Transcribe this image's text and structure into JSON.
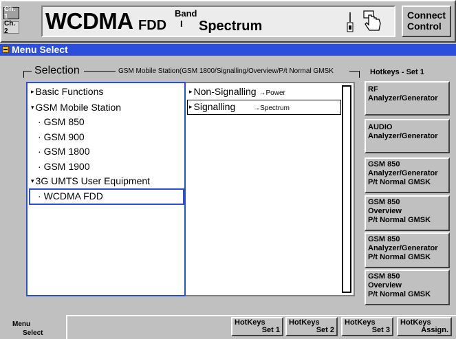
{
  "header": {
    "ch1": "Ch. 1",
    "ch2": "Ch. 2",
    "title_main": "WCDMA",
    "title_sub": "FDD",
    "band_label": "Band",
    "band_value": "I",
    "mode": "Spectrum",
    "connect_line1": "Connect",
    "connect_line2": "Control"
  },
  "menubar": {
    "label": "Menu Select"
  },
  "selection": {
    "title": "Selection",
    "path": "GSM Mobile Station(GSM 1800/Signalling/Overview/P/t Normal GMSK"
  },
  "left_list": [
    {
      "marker": "▸",
      "label": "Basic Functions"
    },
    {
      "marker": "▾",
      "label": "GSM Mobile Station"
    },
    {
      "marker": "·",
      "label": "GSM 850"
    },
    {
      "marker": "·",
      "label": "GSM 900"
    },
    {
      "marker": "·",
      "label": "GSM 1800"
    },
    {
      "marker": "·",
      "label": "GSM 1900"
    },
    {
      "marker": "▾",
      "label": "3G UMTS User Equipment"
    },
    {
      "marker": "·",
      "label": "WCDMA FDD"
    }
  ],
  "right_list": [
    {
      "marker": "▸",
      "label": "Non-Signalling",
      "arrow": "→",
      "target": "Power"
    },
    {
      "marker": "▸",
      "label": "Signalling",
      "arrow": "→",
      "target": "Spectrum"
    }
  ],
  "hotkeys": {
    "title": "Hotkeys - Set 1",
    "buttons": [
      {
        "l1": "RF",
        "l2": "Analyzer/Generator",
        "l3": ""
      },
      {
        "l1": "AUDIO",
        "l2": "Analyzer/Generator",
        "l3": ""
      },
      {
        "l1": "GSM 850",
        "l2": "Analyzer/Generator",
        "l3": "P/t Normal GMSK"
      },
      {
        "l1": "GSM 850",
        "l2": "Overview",
        "l3": "P/t Normal GMSK"
      },
      {
        "l1": "GSM 850",
        "l2": "Analyzer/Generator",
        "l3": "P/t Normal GMSK"
      },
      {
        "l1": "GSM 850",
        "l2": "Overview",
        "l3": "P/t Normal GMSK"
      }
    ]
  },
  "bottom": {
    "label_line1": "Menu",
    "label_line2": "Select",
    "buttons": [
      {
        "l1": "HotKeys",
        "l2": "Set 1"
      },
      {
        "l1": "HotKeys",
        "l2": "Set 2"
      },
      {
        "l1": "HotKeys",
        "l2": "Set 3"
      },
      {
        "l1": "HotKeys",
        "l2": "Assign."
      }
    ]
  }
}
